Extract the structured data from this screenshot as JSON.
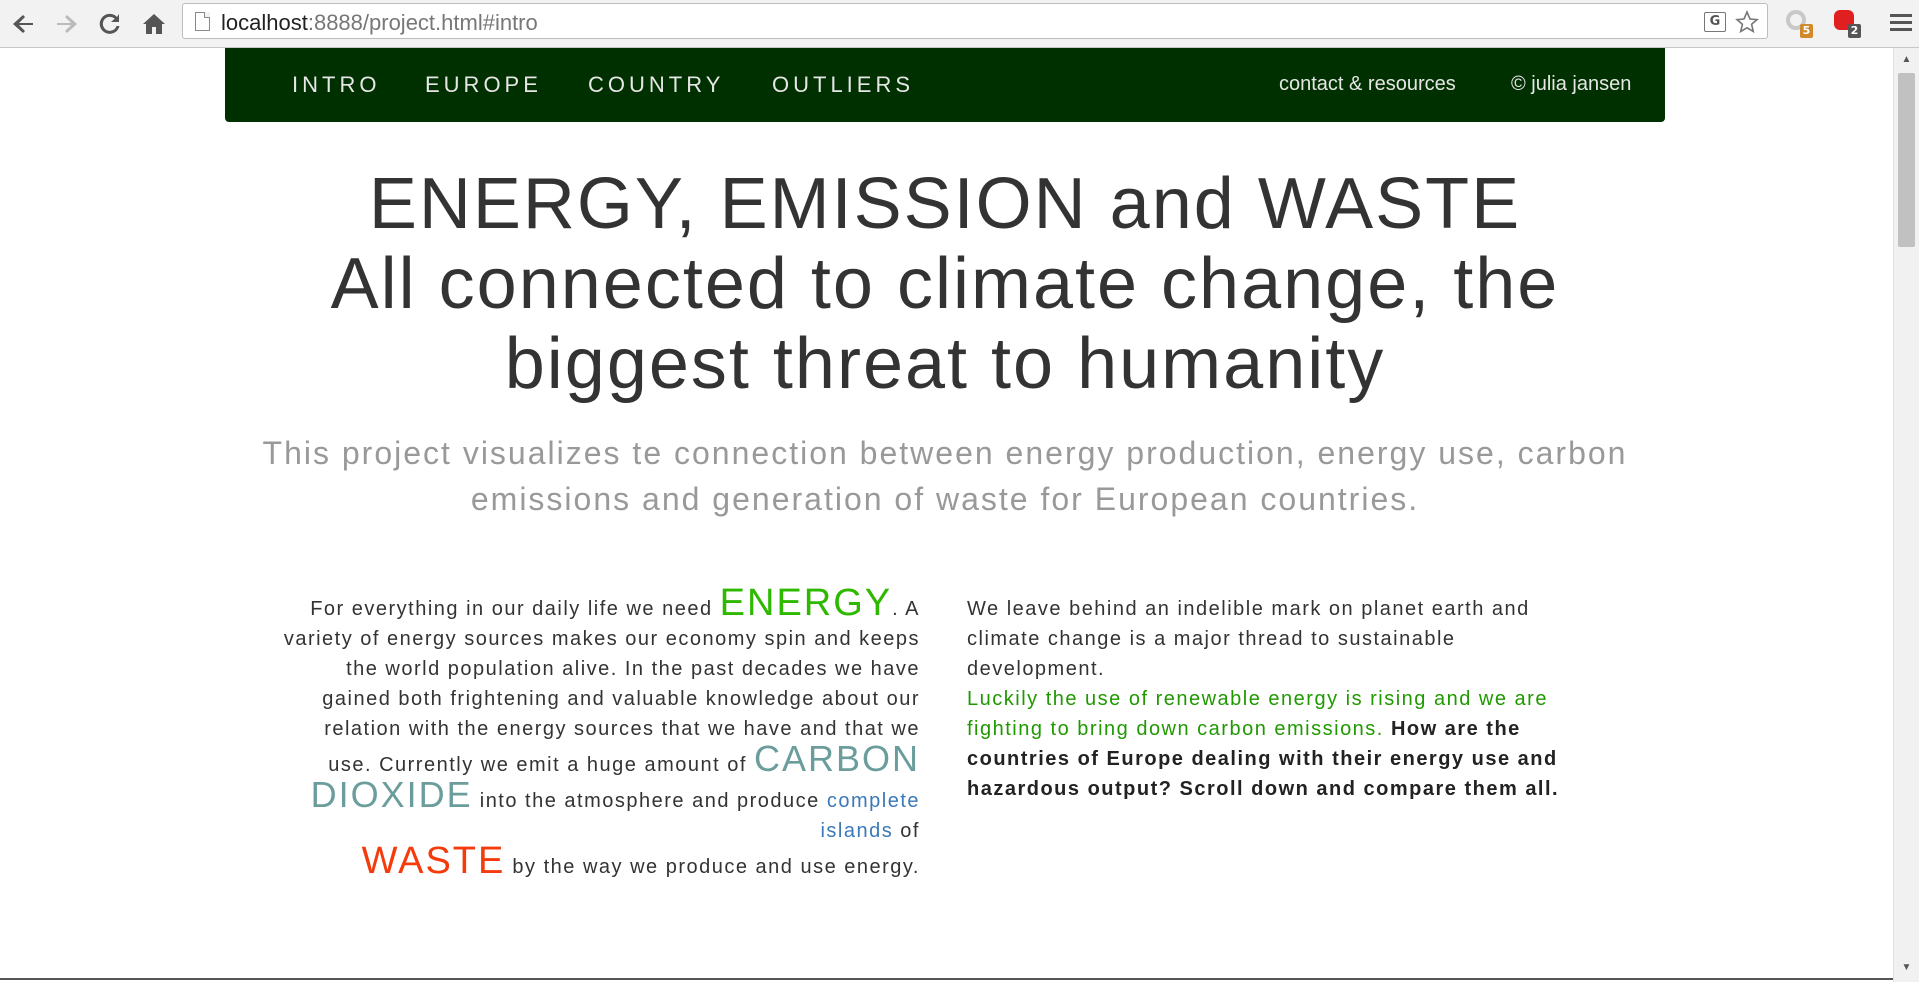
{
  "browser": {
    "url_host": "localhost",
    "url_rest": ":8888/project.html#intro",
    "icons": {
      "back": "back-arrow-icon",
      "forward": "forward-arrow-icon",
      "reload": "reload-icon",
      "home": "home-icon",
      "translate": "translate-icon",
      "bookmark": "star-icon",
      "menu": "hamburger-menu-icon"
    },
    "extensions": [
      {
        "name": "extension-1",
        "badge": "5",
        "color": "#c8c8c8",
        "badge_color": "#d08a2c"
      },
      {
        "name": "adblock-extension",
        "badge": "2",
        "color": "#e02020",
        "badge_color": "#555555"
      }
    ]
  },
  "nav": {
    "links": [
      "INTRO",
      "EUROPE",
      "COUNTRY",
      "OUTLIERS"
    ],
    "contact": "contact & resources",
    "copyright": "© julia jansen",
    "bg_color": "#003000"
  },
  "header": {
    "title_line1": "ENERGY, EMISSION and WASTE",
    "title_line2": "All connected to climate change, the biggest threat to humanity",
    "subtitle": "This project visualizes te connection between energy production, energy use, carbon emissions and generation of waste for European countries."
  },
  "intro": {
    "left": {
      "t1": "For everything in our daily life we need ",
      "kw_energy": "ENERGY",
      "t2": ". A variety of energy sources makes our economy spin and keeps the world population alive. In the past decades we have gained both frightening and valuable knowledge about our relation with the energy sources that we have and that we use. Currently we emit a huge amount of ",
      "kw_co2": "CARBON DIOXIDE",
      "t3": " into the atmosphere and produce ",
      "link_islands": "complete islands",
      "t4": " of ",
      "kw_waste": "WASTE",
      "t5": " by the way we produce and use energy."
    },
    "right": {
      "t1": "We leave behind an indelible mark on planet earth and climate change is a major thread to sustainable development.",
      "green": "Luckily the use of renewable energy is rising and we are fighting to bring down carbon emissions.",
      "bold": "How are the countries of Europe dealing with their energy use and hazardous output? Scroll down and compare them all."
    },
    "colors": {
      "energy": "#2fb800",
      "co2": "#6b9d9d",
      "waste": "#f53a0c",
      "link": "#3a79b8",
      "green_text": "#1f9900"
    }
  }
}
